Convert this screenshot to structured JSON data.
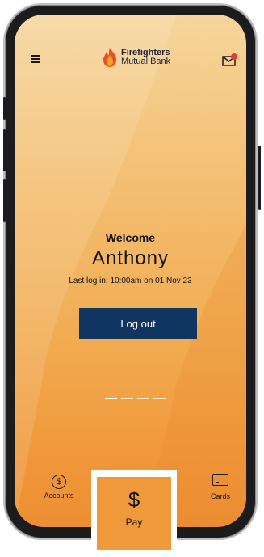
{
  "header": {
    "logo_line1": "Firefighters",
    "logo_line2": "Mutual Bank"
  },
  "welcome": {
    "title": "Welcome",
    "name": "Anthony",
    "last_login": "Last log in: 10:00am on 01 Nov 23"
  },
  "actions": {
    "logout_label": "Log out"
  },
  "pager": {
    "pages": 4,
    "active_index": 0
  },
  "tabbar": {
    "accounts_label": "Accounts",
    "accounts_icon": "dollar-icon",
    "pay_label": "Pay",
    "pay_icon": "dollar-sign-icon",
    "cards_label": "Cards",
    "cards_icon": "card-icon"
  },
  "colors": {
    "accent_orange": "#f0993a",
    "navy": "#0f3560",
    "notification_red": "#e53935"
  }
}
